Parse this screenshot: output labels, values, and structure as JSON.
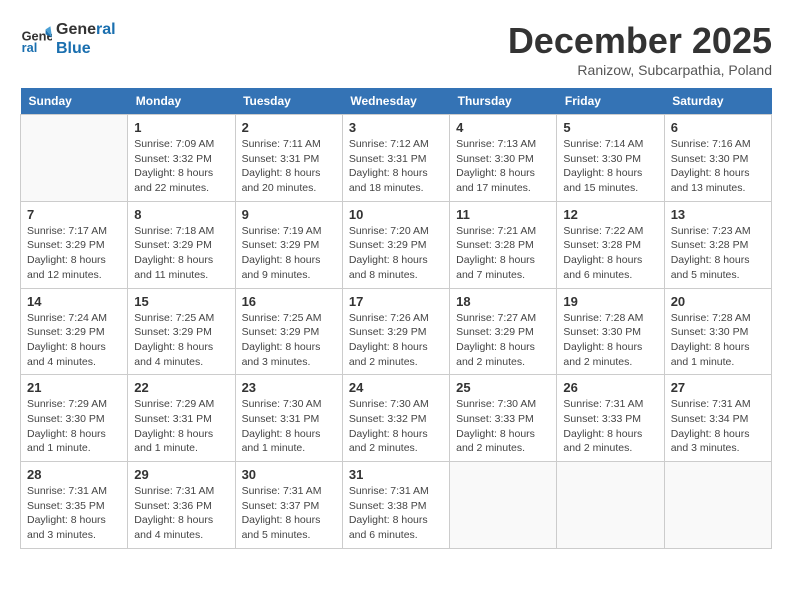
{
  "header": {
    "logo_line1": "General",
    "logo_line2": "Blue",
    "month": "December 2025",
    "location": "Ranizow, Subcarpathia, Poland"
  },
  "weekdays": [
    "Sunday",
    "Monday",
    "Tuesday",
    "Wednesday",
    "Thursday",
    "Friday",
    "Saturday"
  ],
  "weeks": [
    [
      {
        "day": "",
        "info": ""
      },
      {
        "day": "1",
        "info": "Sunrise: 7:09 AM\nSunset: 3:32 PM\nDaylight: 8 hours\nand 22 minutes."
      },
      {
        "day": "2",
        "info": "Sunrise: 7:11 AM\nSunset: 3:31 PM\nDaylight: 8 hours\nand 20 minutes."
      },
      {
        "day": "3",
        "info": "Sunrise: 7:12 AM\nSunset: 3:31 PM\nDaylight: 8 hours\nand 18 minutes."
      },
      {
        "day": "4",
        "info": "Sunrise: 7:13 AM\nSunset: 3:30 PM\nDaylight: 8 hours\nand 17 minutes."
      },
      {
        "day": "5",
        "info": "Sunrise: 7:14 AM\nSunset: 3:30 PM\nDaylight: 8 hours\nand 15 minutes."
      },
      {
        "day": "6",
        "info": "Sunrise: 7:16 AM\nSunset: 3:30 PM\nDaylight: 8 hours\nand 13 minutes."
      }
    ],
    [
      {
        "day": "7",
        "info": "Sunrise: 7:17 AM\nSunset: 3:29 PM\nDaylight: 8 hours\nand 12 minutes."
      },
      {
        "day": "8",
        "info": "Sunrise: 7:18 AM\nSunset: 3:29 PM\nDaylight: 8 hours\nand 11 minutes."
      },
      {
        "day": "9",
        "info": "Sunrise: 7:19 AM\nSunset: 3:29 PM\nDaylight: 8 hours\nand 9 minutes."
      },
      {
        "day": "10",
        "info": "Sunrise: 7:20 AM\nSunset: 3:29 PM\nDaylight: 8 hours\nand 8 minutes."
      },
      {
        "day": "11",
        "info": "Sunrise: 7:21 AM\nSunset: 3:28 PM\nDaylight: 8 hours\nand 7 minutes."
      },
      {
        "day": "12",
        "info": "Sunrise: 7:22 AM\nSunset: 3:28 PM\nDaylight: 8 hours\nand 6 minutes."
      },
      {
        "day": "13",
        "info": "Sunrise: 7:23 AM\nSunset: 3:28 PM\nDaylight: 8 hours\nand 5 minutes."
      }
    ],
    [
      {
        "day": "14",
        "info": "Sunrise: 7:24 AM\nSunset: 3:29 PM\nDaylight: 8 hours\nand 4 minutes."
      },
      {
        "day": "15",
        "info": "Sunrise: 7:25 AM\nSunset: 3:29 PM\nDaylight: 8 hours\nand 4 minutes."
      },
      {
        "day": "16",
        "info": "Sunrise: 7:25 AM\nSunset: 3:29 PM\nDaylight: 8 hours\nand 3 minutes."
      },
      {
        "day": "17",
        "info": "Sunrise: 7:26 AM\nSunset: 3:29 PM\nDaylight: 8 hours\nand 2 minutes."
      },
      {
        "day": "18",
        "info": "Sunrise: 7:27 AM\nSunset: 3:29 PM\nDaylight: 8 hours\nand 2 minutes."
      },
      {
        "day": "19",
        "info": "Sunrise: 7:28 AM\nSunset: 3:30 PM\nDaylight: 8 hours\nand 2 minutes."
      },
      {
        "day": "20",
        "info": "Sunrise: 7:28 AM\nSunset: 3:30 PM\nDaylight: 8 hours\nand 1 minute."
      }
    ],
    [
      {
        "day": "21",
        "info": "Sunrise: 7:29 AM\nSunset: 3:30 PM\nDaylight: 8 hours\nand 1 minute."
      },
      {
        "day": "22",
        "info": "Sunrise: 7:29 AM\nSunset: 3:31 PM\nDaylight: 8 hours\nand 1 minute."
      },
      {
        "day": "23",
        "info": "Sunrise: 7:30 AM\nSunset: 3:31 PM\nDaylight: 8 hours\nand 1 minute."
      },
      {
        "day": "24",
        "info": "Sunrise: 7:30 AM\nSunset: 3:32 PM\nDaylight: 8 hours\nand 2 minutes."
      },
      {
        "day": "25",
        "info": "Sunrise: 7:30 AM\nSunset: 3:33 PM\nDaylight: 8 hours\nand 2 minutes."
      },
      {
        "day": "26",
        "info": "Sunrise: 7:31 AM\nSunset: 3:33 PM\nDaylight: 8 hours\nand 2 minutes."
      },
      {
        "day": "27",
        "info": "Sunrise: 7:31 AM\nSunset: 3:34 PM\nDaylight: 8 hours\nand 3 minutes."
      }
    ],
    [
      {
        "day": "28",
        "info": "Sunrise: 7:31 AM\nSunset: 3:35 PM\nDaylight: 8 hours\nand 3 minutes."
      },
      {
        "day": "29",
        "info": "Sunrise: 7:31 AM\nSunset: 3:36 PM\nDaylight: 8 hours\nand 4 minutes."
      },
      {
        "day": "30",
        "info": "Sunrise: 7:31 AM\nSunset: 3:37 PM\nDaylight: 8 hours\nand 5 minutes."
      },
      {
        "day": "31",
        "info": "Sunrise: 7:31 AM\nSunset: 3:38 PM\nDaylight: 8 hours\nand 6 minutes."
      },
      {
        "day": "",
        "info": ""
      },
      {
        "day": "",
        "info": ""
      },
      {
        "day": "",
        "info": ""
      }
    ]
  ]
}
